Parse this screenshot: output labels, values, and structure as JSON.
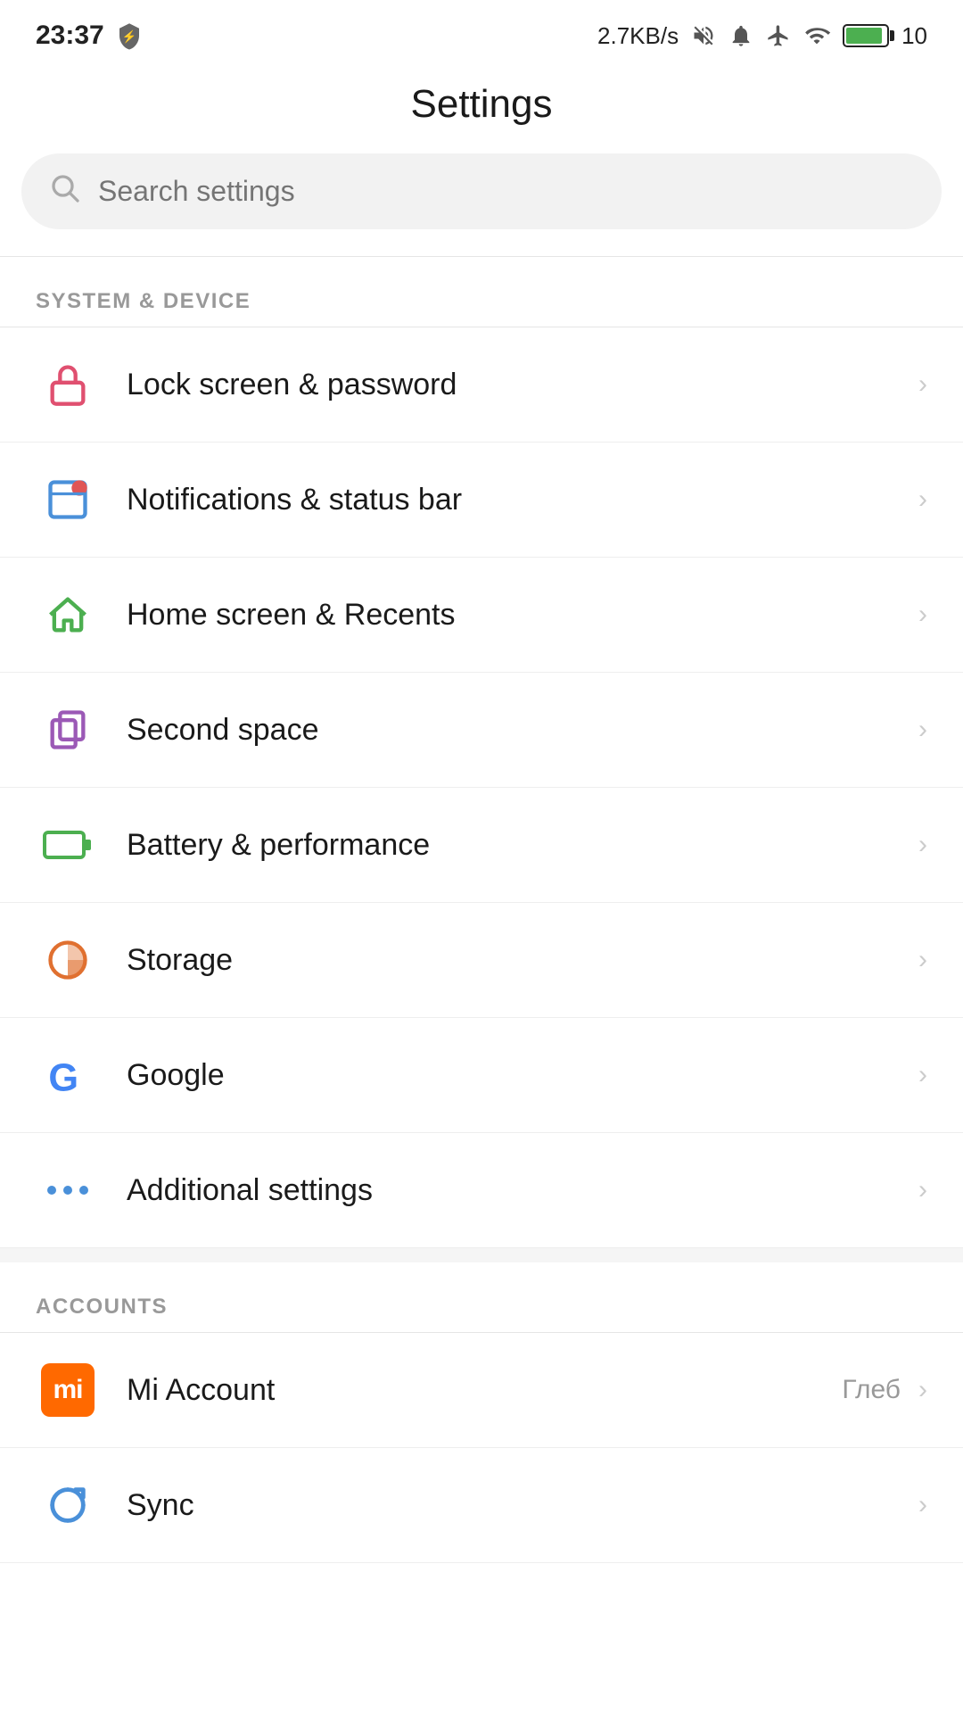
{
  "statusBar": {
    "time": "23:37",
    "networkSpeed": "2.7KB/s",
    "battery": "10"
  },
  "page": {
    "title": "Settings"
  },
  "search": {
    "placeholder": "Search settings"
  },
  "sections": [
    {
      "id": "system-device",
      "header": "SYSTEM & DEVICE",
      "items": [
        {
          "id": "lock-screen",
          "label": "Lock screen & password",
          "icon": "lock-icon",
          "value": ""
        },
        {
          "id": "notifications",
          "label": "Notifications & status bar",
          "icon": "notification-icon",
          "value": ""
        },
        {
          "id": "home-screen",
          "label": "Home screen & Recents",
          "icon": "home-icon",
          "value": ""
        },
        {
          "id": "second-space",
          "label": "Second space",
          "icon": "second-space-icon",
          "value": ""
        },
        {
          "id": "battery",
          "label": "Battery & performance",
          "icon": "battery-perf-icon",
          "value": ""
        },
        {
          "id": "storage",
          "label": "Storage",
          "icon": "storage-icon",
          "value": ""
        },
        {
          "id": "google",
          "label": "Google",
          "icon": "google-icon",
          "value": ""
        },
        {
          "id": "additional",
          "label": "Additional settings",
          "icon": "dots-icon",
          "value": ""
        }
      ]
    },
    {
      "id": "accounts",
      "header": "ACCOUNTS",
      "items": [
        {
          "id": "mi-account",
          "label": "Mi Account",
          "icon": "mi-account-icon",
          "value": "Глеб"
        },
        {
          "id": "sync",
          "label": "Sync",
          "icon": "sync-icon",
          "value": ""
        }
      ]
    }
  ]
}
